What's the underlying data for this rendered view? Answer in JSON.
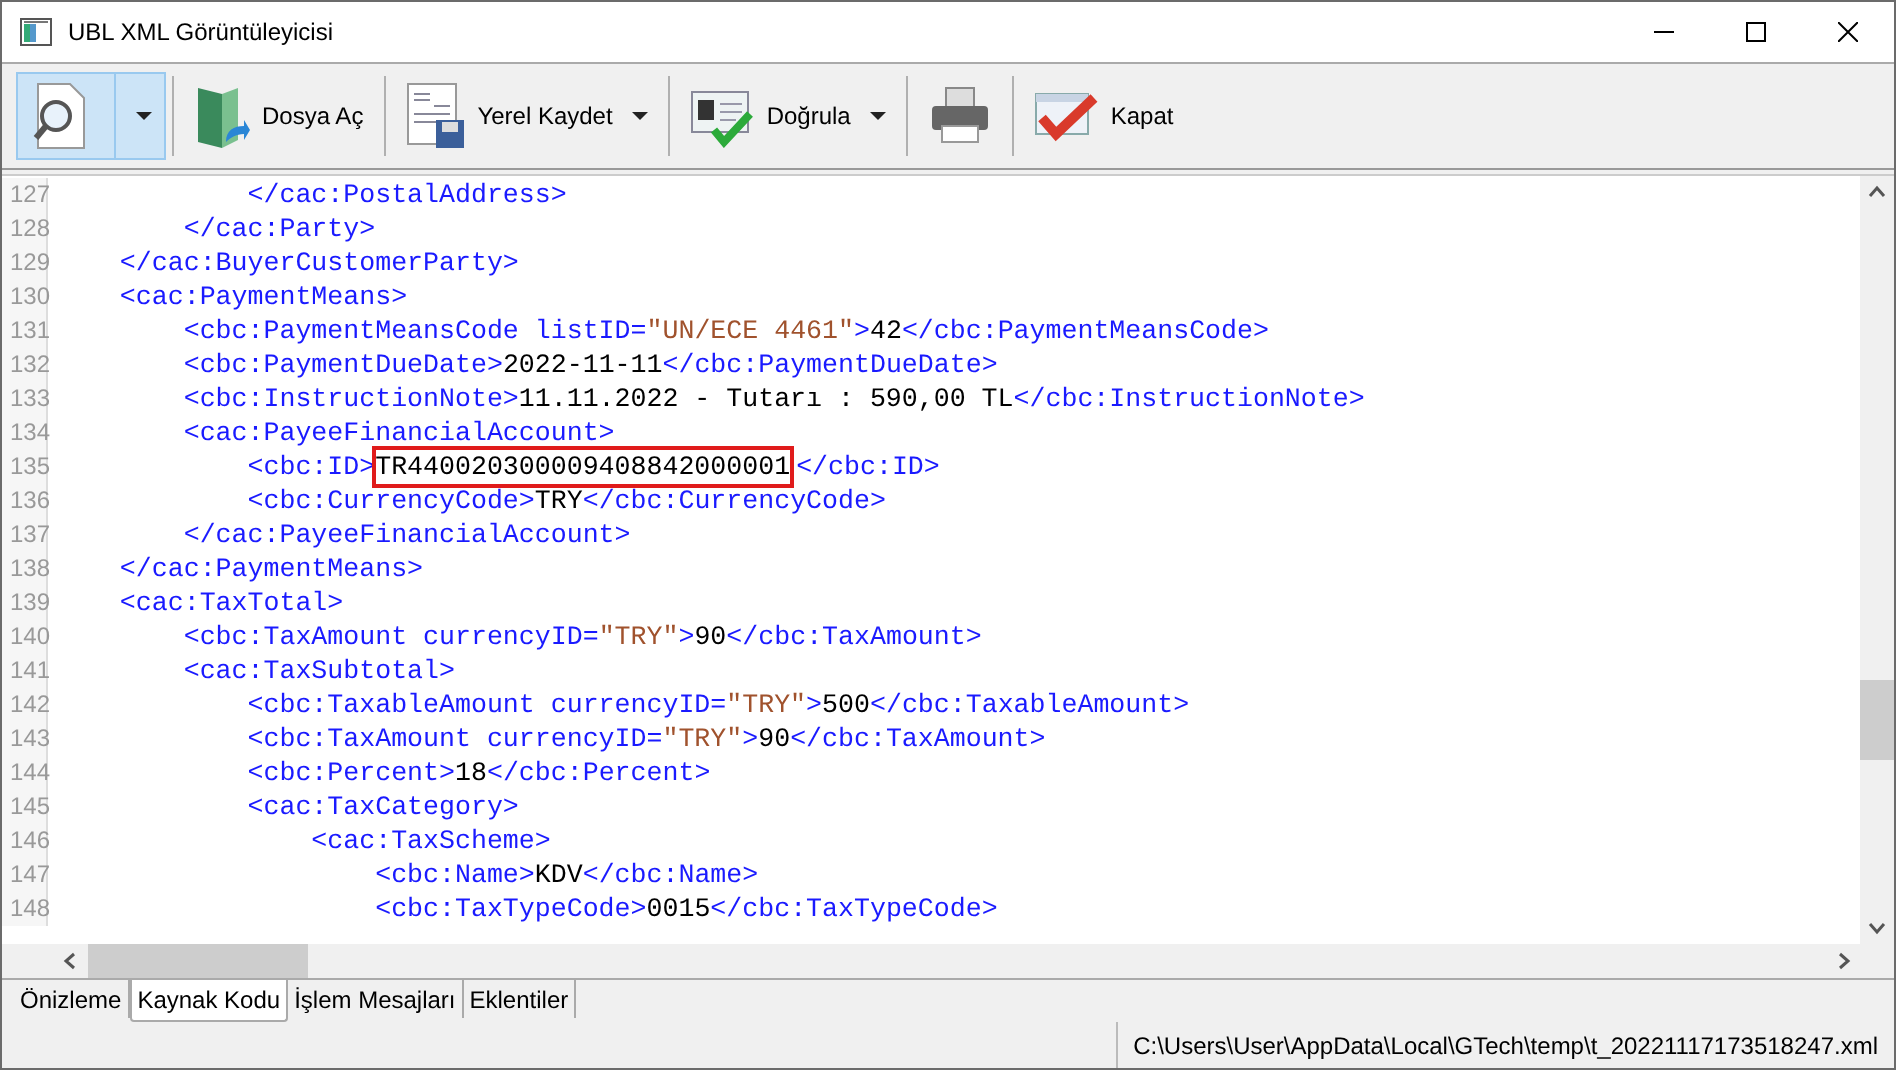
{
  "window": {
    "title": "UBL XML Görüntüleyicisi"
  },
  "toolbar": [
    {
      "kind": "preview",
      "has_dropdown": true,
      "selected": true
    },
    {
      "kind": "open",
      "label": "Dosya Aç",
      "has_dropdown": false,
      "selected": false
    },
    {
      "kind": "save",
      "label": "Yerel Kaydet",
      "has_dropdown": true,
      "selected": false
    },
    {
      "kind": "verify",
      "label": "Doğrula",
      "has_dropdown": true,
      "selected": false
    },
    {
      "kind": "print",
      "has_dropdown": false,
      "selected": false
    },
    {
      "kind": "close",
      "label": "Kapat",
      "has_dropdown": false,
      "selected": false
    }
  ],
  "editor": {
    "lines": [
      {
        "number": "127",
        "segments": [
          {
            "kind": "tag",
            "text": "            </cac:PostalAddress>"
          }
        ]
      },
      {
        "number": "128",
        "segments": [
          {
            "kind": "tag",
            "text": "        </cac:Party>"
          }
        ]
      },
      {
        "number": "129",
        "segments": [
          {
            "kind": "tag",
            "text": "    </cac:BuyerCustomerParty>"
          }
        ]
      },
      {
        "number": "130",
        "segments": [
          {
            "kind": "tag",
            "text": "    <cac:PaymentMeans>"
          }
        ]
      },
      {
        "number": "131",
        "segments": [
          {
            "kind": "tag",
            "text": "        <cbc:PaymentMeansCode listID="
          },
          {
            "kind": "value",
            "text": "\"UN/ECE 4461\""
          },
          {
            "kind": "tag",
            "text": ">"
          },
          {
            "kind": "text",
            "text": "42"
          },
          {
            "kind": "tag",
            "text": "</cbc:PaymentMeansCode>"
          }
        ]
      },
      {
        "number": "132",
        "segments": [
          {
            "kind": "tag",
            "text": "        <cbc:PaymentDueDate>"
          },
          {
            "kind": "text",
            "text": "2022-11-11"
          },
          {
            "kind": "tag",
            "text": "</cbc:PaymentDueDate>"
          }
        ]
      },
      {
        "number": "133",
        "segments": [
          {
            "kind": "tag",
            "text": "        <cbc:InstructionNote>"
          },
          {
            "kind": "text",
            "text": "11.11.2022 - Tutarı : 590,00 TL"
          },
          {
            "kind": "tag",
            "text": "</cbc:InstructionNote>"
          }
        ]
      },
      {
        "number": "134",
        "segments": [
          {
            "kind": "tag",
            "text": "        <cac:PayeeFinancialAccount>"
          }
        ]
      },
      {
        "number": "135",
        "segments": [
          {
            "kind": "tag",
            "text": "            <cbc:ID>"
          },
          {
            "kind": "text",
            "text": "TR440020300009408842000001",
            "highlighted": true
          },
          {
            "kind": "tag",
            "text": "</cbc:ID>"
          }
        ]
      },
      {
        "number": "136",
        "segments": [
          {
            "kind": "tag",
            "text": "            <cbc:CurrencyCode>"
          },
          {
            "kind": "text",
            "text": "TRY"
          },
          {
            "kind": "tag",
            "text": "</cbc:CurrencyCode>"
          }
        ]
      },
      {
        "number": "137",
        "segments": [
          {
            "kind": "tag",
            "text": "        </cac:PayeeFinancialAccount>"
          }
        ]
      },
      {
        "number": "138",
        "segments": [
          {
            "kind": "tag",
            "text": "    </cac:PaymentMeans>"
          }
        ]
      },
      {
        "number": "139",
        "segments": [
          {
            "kind": "tag",
            "text": "    <cac:TaxTotal>"
          }
        ]
      },
      {
        "number": "140",
        "segments": [
          {
            "kind": "tag",
            "text": "        <cbc:TaxAmount currencyID="
          },
          {
            "kind": "value",
            "text": "\"TRY\""
          },
          {
            "kind": "tag",
            "text": ">"
          },
          {
            "kind": "text",
            "text": "90"
          },
          {
            "kind": "tag",
            "text": "</cbc:TaxAmount>"
          }
        ]
      },
      {
        "number": "141",
        "segments": [
          {
            "kind": "tag",
            "text": "        <cac:TaxSubtotal>"
          }
        ]
      },
      {
        "number": "142",
        "segments": [
          {
            "kind": "tag",
            "text": "            <cbc:TaxableAmount currencyID="
          },
          {
            "kind": "value",
            "text": "\"TRY\""
          },
          {
            "kind": "tag",
            "text": ">"
          },
          {
            "kind": "text",
            "text": "500"
          },
          {
            "kind": "tag",
            "text": "</cbc:TaxableAmount>"
          }
        ]
      },
      {
        "number": "143",
        "segments": [
          {
            "kind": "tag",
            "text": "            <cbc:TaxAmount currencyID="
          },
          {
            "kind": "value",
            "text": "\"TRY\""
          },
          {
            "kind": "tag",
            "text": ">"
          },
          {
            "kind": "text",
            "text": "90"
          },
          {
            "kind": "tag",
            "text": "</cbc:TaxAmount>"
          }
        ]
      },
      {
        "number": "144",
        "segments": [
          {
            "kind": "tag",
            "text": "            <cbc:Percent>"
          },
          {
            "kind": "text",
            "text": "18"
          },
          {
            "kind": "tag",
            "text": "</cbc:Percent>"
          }
        ]
      },
      {
        "number": "145",
        "segments": [
          {
            "kind": "tag",
            "text": "            <cac:TaxCategory>"
          }
        ]
      },
      {
        "number": "146",
        "segments": [
          {
            "kind": "tag",
            "text": "                <cac:TaxScheme>"
          }
        ]
      },
      {
        "number": "147",
        "segments": [
          {
            "kind": "tag",
            "text": "                    <cbc:Name>"
          },
          {
            "kind": "text",
            "text": "KDV"
          },
          {
            "kind": "tag",
            "text": "</cbc:Name>"
          }
        ]
      },
      {
        "number": "148",
        "segments": [
          {
            "kind": "tag",
            "text": "                    <cbc:TaxTypeCode>"
          },
          {
            "kind": "text",
            "text": "0015"
          },
          {
            "kind": "tag",
            "text": "</cbc:TaxTypeCode>"
          }
        ]
      }
    ]
  },
  "tabs": [
    {
      "label": "Önizleme",
      "selected": false
    },
    {
      "label": "Kaynak Kodu",
      "selected": true
    },
    {
      "label": "İşlem Mesajları",
      "selected": false
    },
    {
      "label": "Eklentiler",
      "selected": false
    }
  ],
  "status_bar": {
    "path": "C:\\Users\\User\\AppData\\Local\\GTech\\temp\\t_20221117173518247.xml"
  }
}
